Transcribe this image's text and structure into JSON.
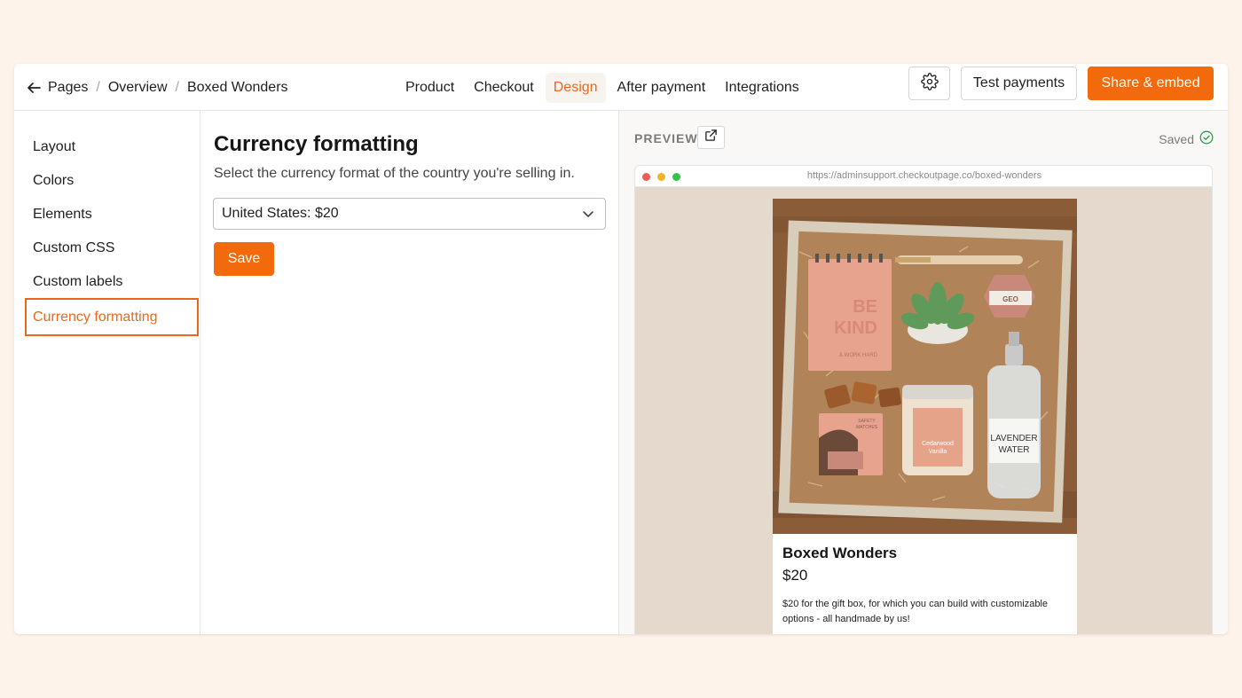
{
  "breadcrumb": {
    "items": [
      "Pages",
      "Overview",
      "Boxed Wonders"
    ],
    "separator": "/"
  },
  "tabs": [
    {
      "label": "Product",
      "active": false
    },
    {
      "label": "Checkout",
      "active": false
    },
    {
      "label": "Design",
      "active": true
    },
    {
      "label": "After payment",
      "active": false
    },
    {
      "label": "Integrations",
      "active": false
    }
  ],
  "header": {
    "settings_icon": "gear-icon",
    "test_payments_label": "Test payments",
    "share_label": "Share & embed"
  },
  "sidebar": {
    "items": [
      {
        "label": "Layout",
        "active": false
      },
      {
        "label": "Colors",
        "active": false
      },
      {
        "label": "Elements",
        "active": false
      },
      {
        "label": "Custom CSS",
        "active": false
      },
      {
        "label": "Custom labels",
        "active": false
      },
      {
        "label": "Currency formatting",
        "active": true
      }
    ]
  },
  "main": {
    "title": "Currency formatting",
    "description": "Select the currency format of the country you're selling in.",
    "currency_select": {
      "value": "United States: $20"
    },
    "save_label": "Save"
  },
  "preview": {
    "label": "PREVIEW",
    "status": "Saved",
    "url": "https://adminsupport.checkoutpage.co/boxed-wonders",
    "product": {
      "name": "Boxed Wonders",
      "price": "$20",
      "description": "$20 for the gift box, for which you can build with customizable options - all handmade by us!",
      "image_text": {
        "notebook": [
          "BE",
          "KIND"
        ],
        "notebook_small": "& WORK HARD",
        "candle": [
          "Cedarwood",
          "Vanilla"
        ],
        "bottle": [
          "LAVENDER",
          "WATER"
        ],
        "matches": [
          "SAFETY",
          "MATCHES"
        ],
        "soap": "GEO"
      }
    }
  },
  "colors": {
    "accent": "#f26a0b",
    "accent_text": "#e9681e",
    "page_bg": "#fdf3ea",
    "preview_bg": "#e5d9cd"
  }
}
